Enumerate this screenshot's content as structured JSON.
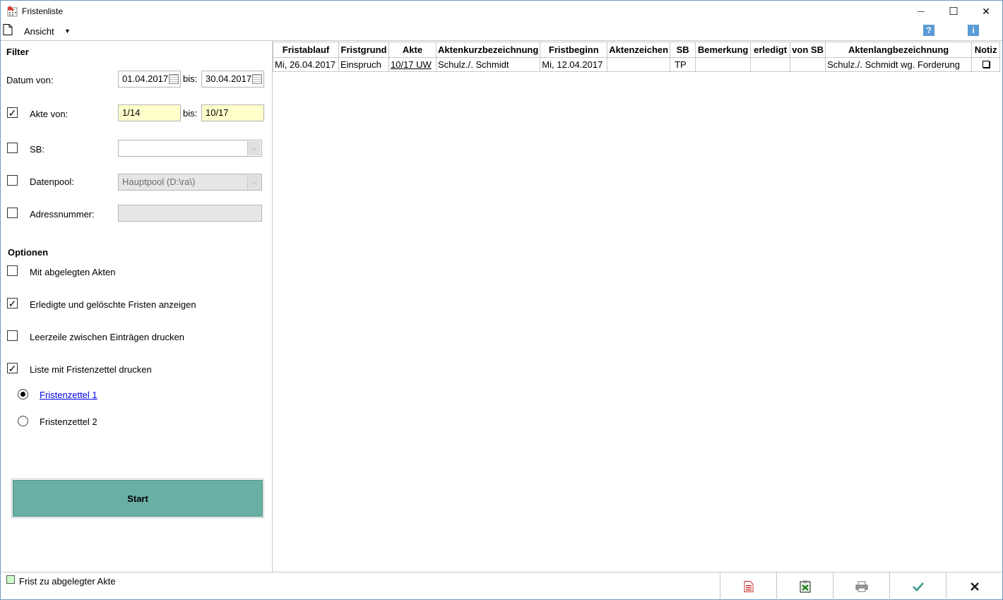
{
  "window": {
    "title": "Fristenliste",
    "minimize_glyph": "—",
    "maximize_glyph": "☐",
    "close_glyph": "✕"
  },
  "menu": {
    "ansicht": "Ansicht",
    "ansicht_arrow": "▼",
    "help_glyph": "?",
    "info_glyph": "i"
  },
  "filter": {
    "heading": "Filter",
    "datum_label": "Datum von:",
    "datum_von": "01.04.2017",
    "datum_bis_label": "bis:",
    "datum_bis": "30.04.2017",
    "akte_label": "Akte von:",
    "akte_checked": true,
    "akte_von": "1/14",
    "akte_bis_label": "bis:",
    "akte_bis": "10/17",
    "sb_label": "SB:",
    "sb_checked": false,
    "sb_value": "",
    "datenpool_label": "Datenpool:",
    "datenpool_checked": false,
    "datenpool_value": "Hauptpool (D:\\ra\\)",
    "adressnummer_label": "Adressnummer:",
    "adressnummer_checked": false,
    "adressnummer_value": ""
  },
  "optionen": {
    "heading": "Optionen",
    "items": [
      {
        "label": "Mit abgelegten Akten",
        "checked": false
      },
      {
        "label": "Erledigte und gelöschte Fristen anzeigen",
        "checked": true
      },
      {
        "label": "Leerzeile zwischen Einträgen drucken",
        "checked": false
      },
      {
        "label": "Liste mit Fristenzettel drucken",
        "checked": true
      }
    ],
    "radios": [
      {
        "label": "Fristenzettel 1",
        "selected": true
      },
      {
        "label": "Fristenzettel 2",
        "selected": false
      }
    ]
  },
  "start_label": "Start",
  "grid": {
    "columns": [
      "Fristablauf",
      "Fristgrund",
      "Akte",
      "Aktenkurzbezeichnung",
      "Fristbeginn",
      "Aktenzeichen",
      "SB",
      "Bemerkung",
      "erledigt",
      "von SB",
      "Aktenlangbezeichnung",
      "Notiz"
    ],
    "rows": [
      {
        "fristablauf": "Mi, 26.04.2017",
        "fristgrund": "Einspruch",
        "akte": "10/17 UW",
        "aktenkurzbezeichnung": "Schulz./. Schmidt",
        "fristbeginn": "Mi, 12.04.2017",
        "aktenzeichen": "",
        "sb": "TP",
        "bemerkung": "",
        "erledigt": "",
        "von_sb": "",
        "aktenlangbezeichnung": "Schulz./. Schmidt wg. Forderung",
        "notiz_icon": "note-icon"
      }
    ]
  },
  "status": {
    "legend_text": "Frist zu abgelegter Akte",
    "legend_color": "#ccffcc"
  },
  "colors": {
    "start_button": "#6aafa4",
    "input_highlight": "#ffffcc",
    "help_icon": "#5b9bd5"
  },
  "icons": {
    "bottom_buttons": [
      "pdf-export-icon",
      "excel-export-icon",
      "print-icon",
      "ok-check-icon",
      "cancel-x-icon"
    ]
  }
}
